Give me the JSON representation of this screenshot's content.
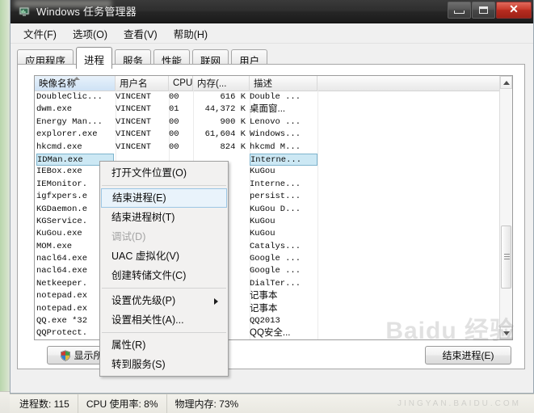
{
  "window": {
    "title": "Windows 任务管理器",
    "icon": "task-manager-icon",
    "minimize_label": "",
    "maximize_label": "",
    "close_label": "✕"
  },
  "menubar": {
    "items": [
      {
        "label": "文件(F)"
      },
      {
        "label": "选项(O)"
      },
      {
        "label": "查看(V)"
      },
      {
        "label": "帮助(H)"
      }
    ]
  },
  "tabs": [
    {
      "label": "应用程序",
      "active": false
    },
    {
      "label": "进程",
      "active": true
    },
    {
      "label": "服务",
      "active": false
    },
    {
      "label": "性能",
      "active": false
    },
    {
      "label": "联网",
      "active": false
    },
    {
      "label": "用户",
      "active": false
    }
  ],
  "process_table": {
    "columns": [
      {
        "label": "映像名称",
        "sorted": true,
        "sort_direction": "asc"
      },
      {
        "label": "用户名",
        "sorted": false
      },
      {
        "label": "CPU",
        "sorted": false
      },
      {
        "label": "内存(...",
        "sorted": false
      },
      {
        "label": "描述",
        "sorted": false
      }
    ],
    "rows": [
      {
        "name": "DoubleClic...",
        "user": "VINCENT",
        "cpu": "00",
        "mem": "616 K",
        "desc": "Double ...",
        "desc_cjk": false,
        "selected": false
      },
      {
        "name": "dwm.exe",
        "user": "VINCENT",
        "cpu": "01",
        "mem": "44,372 K",
        "desc": "桌面窗...",
        "desc_cjk": true,
        "selected": false
      },
      {
        "name": "Energy Man...",
        "user": "VINCENT",
        "cpu": "00",
        "mem": "900 K",
        "desc": "Lenovo ...",
        "desc_cjk": false,
        "selected": false
      },
      {
        "name": "explorer.exe",
        "user": "VINCENT",
        "cpu": "00",
        "mem": "61,604 K",
        "desc": "Windows...",
        "desc_cjk": false,
        "selected": false
      },
      {
        "name": "hkcmd.exe",
        "user": "VINCENT",
        "cpu": "00",
        "mem": "824 K",
        "desc": "hkcmd M...",
        "desc_cjk": false,
        "selected": false
      },
      {
        "name": "IDMan.exe ",
        "user": "",
        "cpu": "",
        "mem": "",
        "desc": "Interne...",
        "desc_cjk": false,
        "selected": true
      },
      {
        "name": "IEBox.exe ",
        "user": "",
        "cpu": "",
        "mem": "",
        "desc": "KuGou",
        "desc_cjk": false,
        "selected": false
      },
      {
        "name": "IEMonitor.",
        "user": "",
        "cpu": "",
        "mem": "",
        "desc": "Interne...",
        "desc_cjk": false,
        "selected": false
      },
      {
        "name": "igfxpers.e",
        "user": "",
        "cpu": "",
        "mem": "",
        "desc": "persist...",
        "desc_cjk": false,
        "selected": false
      },
      {
        "name": "KGDaemon.e",
        "user": "",
        "cpu": "",
        "mem": "",
        "desc": "KuGou D...",
        "desc_cjk": false,
        "selected": false
      },
      {
        "name": "KGService.",
        "user": "",
        "cpu": "",
        "mem": "",
        "desc": "KuGou",
        "desc_cjk": false,
        "selected": false
      },
      {
        "name": "KuGou.exe ",
        "user": "",
        "cpu": "",
        "mem": "",
        "desc": "KuGou",
        "desc_cjk": false,
        "selected": false
      },
      {
        "name": "MOM.exe",
        "user": "",
        "cpu": "",
        "mem": "",
        "desc": "Catalys...",
        "desc_cjk": false,
        "selected": false
      },
      {
        "name": "nacl64.exe",
        "user": "",
        "cpu": "",
        "mem": "",
        "desc": "Google ...",
        "desc_cjk": false,
        "selected": false
      },
      {
        "name": "nacl64.exe",
        "user": "",
        "cpu": "",
        "mem": "",
        "desc": "Google ...",
        "desc_cjk": false,
        "selected": false
      },
      {
        "name": "Netkeeper.",
        "user": "",
        "cpu": "",
        "mem": "",
        "desc": "DialTer...",
        "desc_cjk": false,
        "selected": false
      },
      {
        "name": "notepad.ex",
        "user": "",
        "cpu": "",
        "mem": "",
        "desc": "记事本",
        "desc_cjk": true,
        "selected": false
      },
      {
        "name": "notepad.ex",
        "user": "",
        "cpu": "",
        "mem": "",
        "desc": "记事本",
        "desc_cjk": true,
        "selected": false
      },
      {
        "name": "QQ.exe *32",
        "user": "",
        "cpu": "",
        "mem": "",
        "desc": "QQ2013",
        "desc_cjk": false,
        "selected": false
      },
      {
        "name": "QQProtect.",
        "user": "",
        "cpu": "",
        "mem": "",
        "desc": "QQ安全...",
        "desc_cjk": true,
        "selected": false
      }
    ]
  },
  "context_menu": {
    "items": [
      {
        "label": "打开文件位置(O)",
        "state": "normal",
        "submenu": false
      },
      {
        "separator": true
      },
      {
        "label": "结束进程(E)",
        "state": "highlight",
        "submenu": false
      },
      {
        "label": "结束进程树(T)",
        "state": "normal",
        "submenu": false
      },
      {
        "label": "调试(D)",
        "state": "disabled",
        "submenu": false
      },
      {
        "label": "UAC 虚拟化(V)",
        "state": "normal",
        "submenu": false
      },
      {
        "label": "创建转储文件(C)",
        "state": "normal",
        "submenu": false
      },
      {
        "separator": true
      },
      {
        "label": "设置优先级(P)",
        "state": "normal",
        "submenu": true
      },
      {
        "label": "设置相关性(A)...",
        "state": "normal",
        "submenu": false
      },
      {
        "separator": true
      },
      {
        "label": "属性(R)",
        "state": "normal",
        "submenu": false
      },
      {
        "label": "转到服务(S)",
        "state": "normal",
        "submenu": false
      }
    ]
  },
  "buttons": {
    "show_all_users": "显示所有用户的进程(S)",
    "end_process": "结束进程(E)"
  },
  "statusbar": {
    "process_count": "进程数: 115",
    "cpu_usage": "CPU 使用率: 8%",
    "physical_memory": "物理内存: 73%"
  },
  "watermark": {
    "main": "Baidu 经验",
    "sub": "JINGYAN.BAIDU.COM"
  },
  "colors": {
    "selection": "#cce8f4",
    "selection_border": "#7eb4cd",
    "menu_highlight": "#e9f3fb",
    "close_button": "#c93b2c",
    "titlebar": "#262626"
  }
}
